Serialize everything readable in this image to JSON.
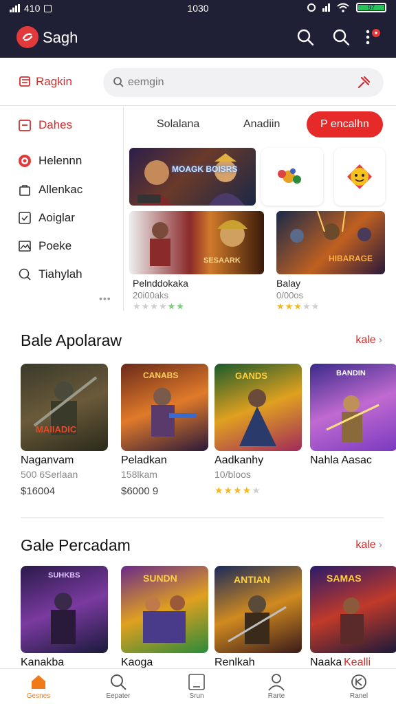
{
  "status_bar": {
    "left": "410",
    "time": "1030"
  },
  "app_bar": {
    "title": "Sagh"
  },
  "subheader": {
    "brand": "Ragkin",
    "search_placeholder": "eemgin"
  },
  "sidebar": {
    "items": [
      {
        "label": "Dahes",
        "icon": "calendar-icon",
        "active": true
      },
      {
        "label": "Helennn",
        "icon": "circle-badge-icon"
      },
      {
        "label": "Allenkac",
        "icon": "bag-icon"
      },
      {
        "label": "Aoiglar",
        "icon": "checkbox-icon"
      },
      {
        "label": "Poeke",
        "icon": "image-icon"
      },
      {
        "label": "Tiahylah",
        "icon": "search-icon"
      }
    ],
    "more": "•••"
  },
  "tabs": [
    {
      "label": "Solalana"
    },
    {
      "label": "Anadiin"
    },
    {
      "label": "P encalhn",
      "active": true
    }
  ],
  "featured": {
    "banner_text": "MOAGK BOISRS",
    "left_game": {
      "art_text": "SESAARK",
      "name": "Pelnddokaka",
      "sub": "20i00aks"
    },
    "right_game": {
      "art_text": "HIBARAGE",
      "name": "Balay",
      "sub": "0/00os",
      "rating": 3
    }
  },
  "section1": {
    "title": "Bale Apolaraw",
    "see_more": "kale",
    "cards": [
      {
        "art_text": "MAIIADIC",
        "name": "Naganvam",
        "sub": "500 6Serlaan",
        "price": "$16004"
      },
      {
        "art_text": "CANABS",
        "name": "Peladkan",
        "sub": "158lkam",
        "price": "$6000 9"
      },
      {
        "art_text": "GANDS",
        "name": "Aadkanhy",
        "sub": "10/bloos",
        "rating": 4.5
      },
      {
        "art_text": "BANDIN",
        "name": "Nahla Aasac",
        "sub": ""
      }
    ]
  },
  "section2": {
    "title": "Gale Percadam",
    "see_more": "kale",
    "cards": [
      {
        "art_text": "SUHKBS",
        "name": "Kanakba"
      },
      {
        "art_text": "SUNDN",
        "name": "Kaoga"
      },
      {
        "art_text": "ANTIAN",
        "name": "Renlkah"
      },
      {
        "art_text": "SAMAS",
        "name": "Naaka",
        "tag": "Kealli"
      }
    ]
  },
  "bottom_nav": [
    {
      "label": "Gesnes",
      "icon": "home-icon",
      "active": true
    },
    {
      "label": "Eepater",
      "icon": "search-icon"
    },
    {
      "label": "Srun",
      "icon": "square-icon"
    },
    {
      "label": "Rarte",
      "icon": "person-icon"
    },
    {
      "label": "Ranel",
      "icon": "settings-icon"
    }
  ],
  "colors": {
    "accent": "#e62a2a",
    "dark": "#1f1f36",
    "home": "#f07a1a",
    "star": "#f2b824"
  }
}
